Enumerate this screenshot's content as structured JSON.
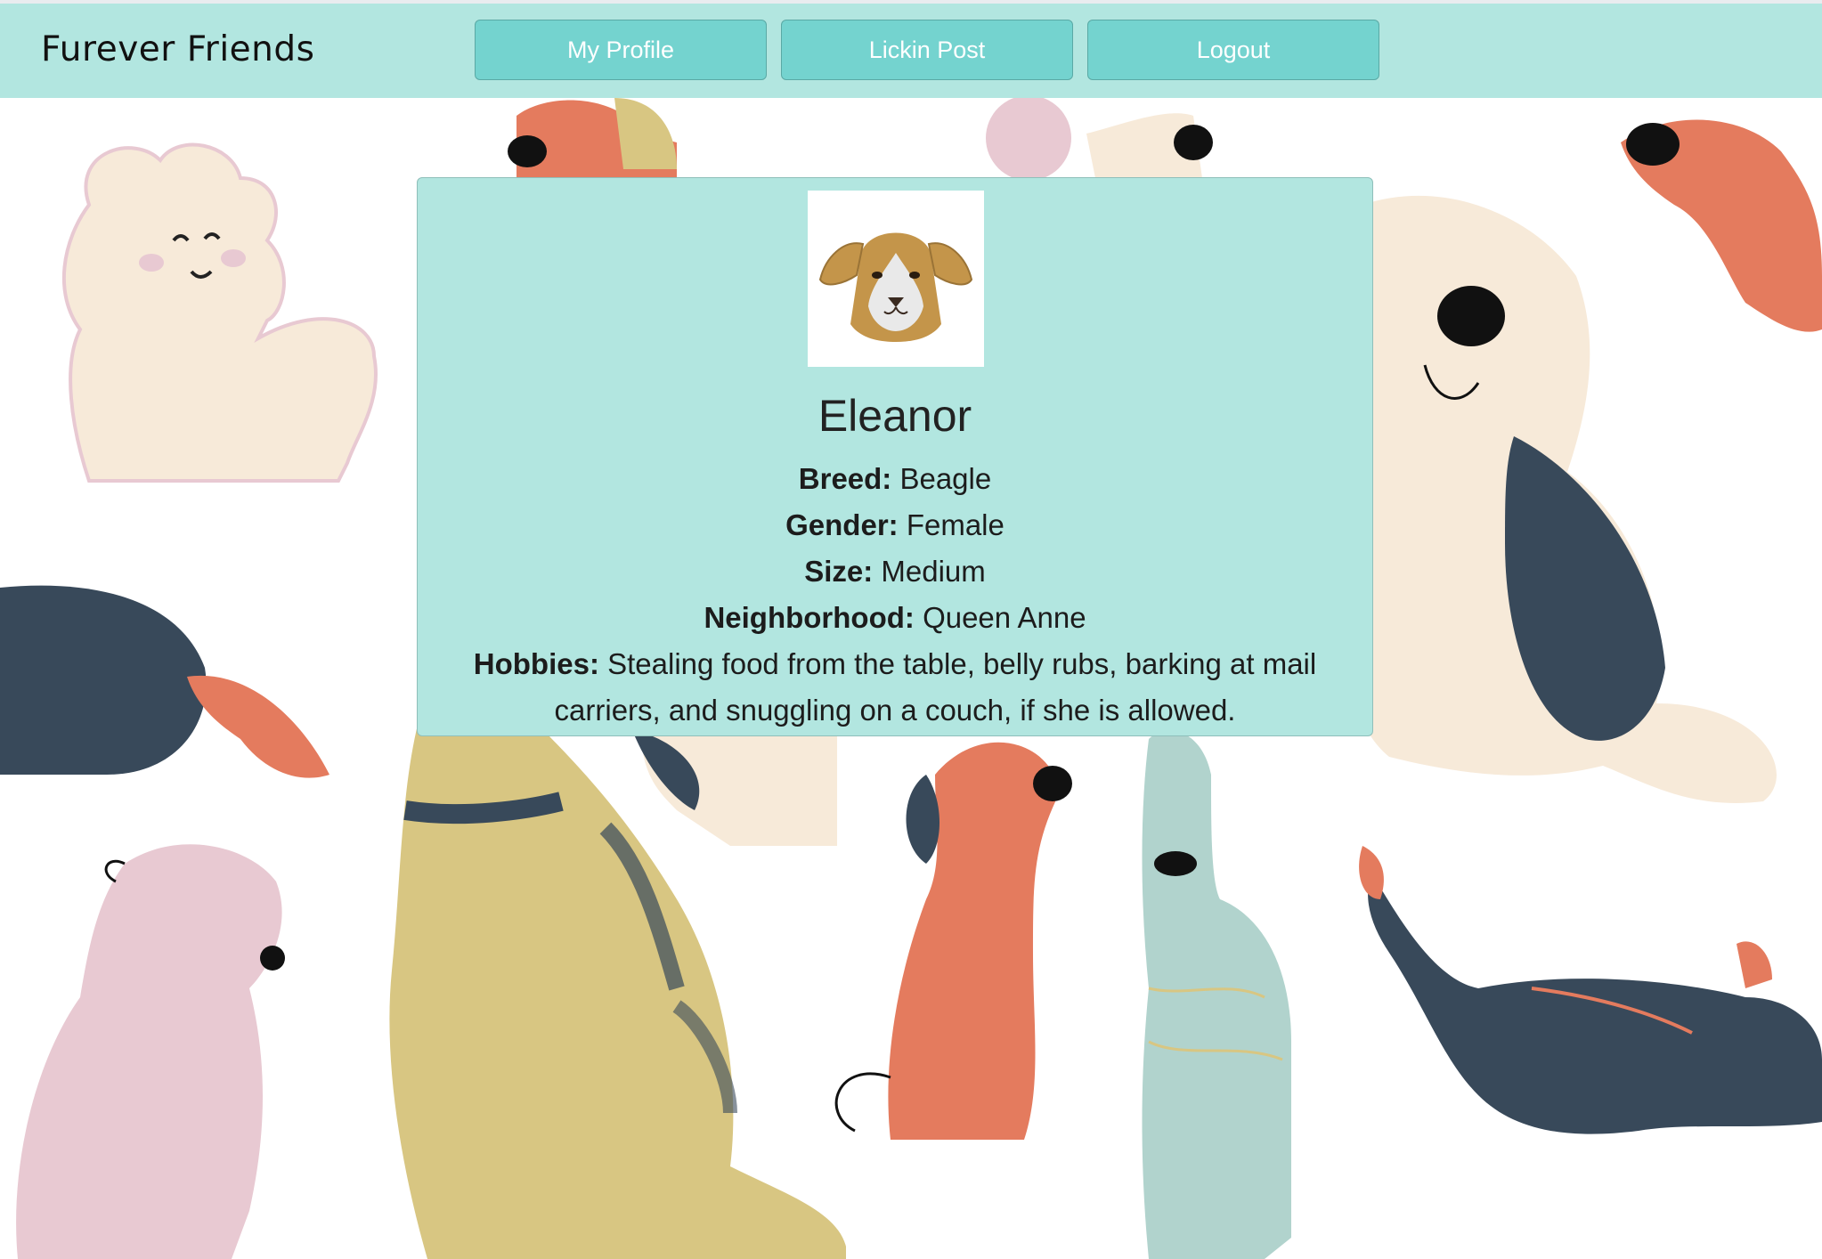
{
  "navbar": {
    "brand": "Furever Friends",
    "buttons": [
      {
        "label": "My Profile"
      },
      {
        "label": "Lickin Post"
      },
      {
        "label": "Logout"
      }
    ]
  },
  "profile": {
    "name": "Eleanor",
    "avatar_icon": "dog-face-icon",
    "fields": [
      {
        "label": "Breed:",
        "value": "Beagle"
      },
      {
        "label": "Gender:",
        "value": "Female"
      },
      {
        "label": "Size:",
        "value": "Medium"
      },
      {
        "label": "Neighborhood:",
        "value": "Queen Anne"
      },
      {
        "label": "Hobbies:",
        "value": "Stealing food from the table, belly rubs, barking at mail carriers, and snuggling on a couch, if she is allowed."
      }
    ]
  },
  "colors": {
    "nav_bg": "#b2e6e0",
    "button_bg": "#74d3cf",
    "card_bg": "#b2e6e0",
    "dog_navy": "#38495a",
    "dog_orange": "#e47b5e",
    "dog_cream": "#f7ead9",
    "dog_pink": "#e8c9d2",
    "dog_yellow": "#d8c682",
    "dog_teal": "#b1d3cd"
  }
}
